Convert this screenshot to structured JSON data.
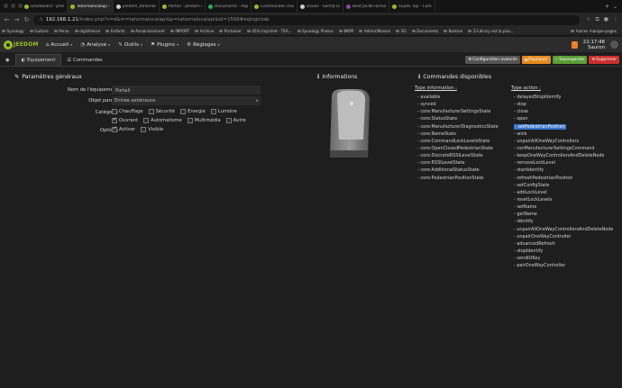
{
  "browser": {
    "tabs": [
      {
        "title": "Dashboard - Jeedom Atlas",
        "active": false,
        "color": "#94c11f"
      },
      {
        "title": "Tahomalocalapi - Jeedom",
        "active": true,
        "color": "#94c11f"
      },
      {
        "title": "jeedom_tahomalocalapi/c",
        "active": false,
        "color": "#cccccc"
      },
      {
        "title": "Portail - Jeedom Atlas",
        "active": false,
        "color": "#94c11f"
      },
      {
        "title": "Documents - Paperless-ng",
        "active": false,
        "color": "#27ae60"
      },
      {
        "title": "Commandes manquantes",
        "active": false,
        "color": "#94c11f"
      },
      {
        "title": "Issues · Somfy-Developer/",
        "active": false,
        "color": "#cccccc"
      },
      {
        "title": "Best JSON Formatter and",
        "active": false,
        "color": "#8e44ad"
      },
      {
        "title": "Sujets Top - Communauté",
        "active": false,
        "color": "#94c11f"
      }
    ],
    "url": {
      "not_secure": "⚠",
      "host": "192.168.1.21",
      "path": "/index.php?v=d&m=tahomalocalapi&p=tahomalocalapi&id=1566#eqlogictab"
    },
    "bookmarks": [
      "Synology",
      "Guitare",
      "Perso",
      "digitAdvice",
      "Enfants",
      "Assainissement",
      "IMPORT",
      "Archive",
      "Portainer",
      "45% imprimé - TEA...",
      "Synology Photos",
      "BNPP",
      "Admin/Maison",
      "SG",
      "Documents",
      "Bastion",
      "Z-Library est la plus..."
    ],
    "bookmarks_other": "Autres marque-pages"
  },
  "jeedom": {
    "logo": "JEEDOM",
    "menus": [
      {
        "label": "Accueil",
        "icon": "home-icon",
        "glyph": "⌂"
      },
      {
        "label": "Analyse",
        "icon": "chart-icon",
        "glyph": "◔"
      },
      {
        "label": "Outils",
        "icon": "wrench-icon",
        "glyph": "✎"
      },
      {
        "label": "Plugins",
        "icon": "tasks-icon",
        "glyph": "⚑"
      },
      {
        "label": "Réglages",
        "icon": "cogs-icon",
        "glyph": "⚙"
      }
    ],
    "time": "22:17:48",
    "user": "Sauron"
  },
  "page_tabs": {
    "equipement": "Equipement",
    "commandes": "Commandes"
  },
  "actions": {
    "config": "Configuration avancée",
    "duplicate": "Dupliquer",
    "save": "Sauvegarder",
    "delete": "Supprimer"
  },
  "params": {
    "title": "Paramètres généraux",
    "name_label": "Nom de l'équipement",
    "name_value": "Portail",
    "parent_label": "Objet parent",
    "parent_value": "Entrée extérieure",
    "category_label": "Catégorie",
    "categories": [
      {
        "label": "Chauffage",
        "checked": false
      },
      {
        "label": "Sécurité",
        "checked": false
      },
      {
        "label": "Energie",
        "checked": false
      },
      {
        "label": "Lumière",
        "checked": false
      },
      {
        "label": "Ouvrant",
        "checked": true
      },
      {
        "label": "Automatisme",
        "checked": false
      },
      {
        "label": "Multimédia",
        "checked": false
      },
      {
        "label": "Autre",
        "checked": false
      }
    ],
    "options_label": "Options",
    "options": [
      {
        "label": "Activer",
        "checked": true
      },
      {
        "label": "Visible",
        "checked": false
      }
    ]
  },
  "info": {
    "title": "Informations"
  },
  "commands": {
    "title": "Commandes disponibles",
    "info_head": "Type information :",
    "info_list": [
      "- available",
      "- synced",
      "- core:ManufacturerSettingsState",
      "- core:StatusState",
      "- core:ManufacturerDiagnosticsState",
      "- core:NameState",
      "- core:CommandLockLevelsState",
      "- core:OpenClosedPedestrianState",
      "- core:DiscreteRSSILevelState",
      "- core:RSSILevelState",
      "- core:AdditionalStatusState",
      "- core:PedestrianPositionState"
    ],
    "action_head": "Type action :",
    "action_list": [
      "- delayedStopIdentify",
      "- stop",
      "- close",
      "- open",
      "- setPedestrianPosition",
      "- wink",
      "- unpairAllOneWayControllers",
      "- runManufacturerSettingsCommand",
      "- keepOneWayControllersAndDeleteNode",
      "- removeLockLevel",
      "- startIdentify",
      "- refreshPedestrianPosition",
      "- setConfigState",
      "- addLockLevel",
      "- resetLockLevels",
      "- setName",
      "- getName",
      "- identify",
      "- unpairAllOneWayControllersAndDeleteNode",
      "- unpairOneWayController",
      "- advancedRefresh",
      "- stopIdentify",
      "- sendIOKey",
      "- pairOneWayController"
    ],
    "selected_action": "- setPedestrianPosition"
  }
}
